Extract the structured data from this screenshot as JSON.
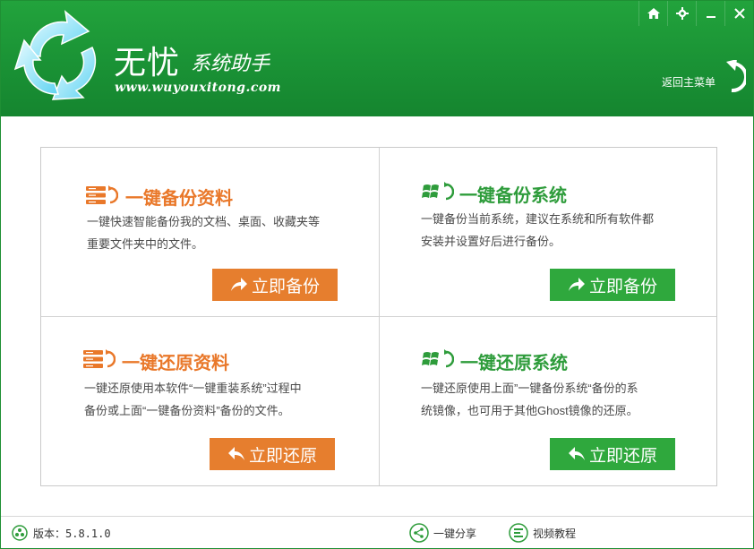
{
  "header": {
    "brand_name": "无忧",
    "brand_sub": "系统助手",
    "brand_url": "www.wuyouxitong.com",
    "back_menu_label": "返回主菜单",
    "top_buttons": [
      "home-icon",
      "gear-icon",
      "minimize-icon",
      "close-icon"
    ]
  },
  "cells": {
    "backup_data": {
      "title": "一键备份资料",
      "desc_line1": "一键快速智能备份我的文档、桌面、收藏夹等",
      "desc_line2": "重要文件夹中的文件。",
      "button": "立即备份"
    },
    "backup_system": {
      "title": "一键备份系统",
      "desc_line1": "一键备份当前系统，建议在系统和所有软件都",
      "desc_line2": "安装并设置好后进行备份。",
      "button": "立即备份"
    },
    "restore_data": {
      "title": "一键还原资料",
      "desc_line1": "一键还原使用本软件“一键重装系统”过程中",
      "desc_line2": "备份或上面“一键备份资料”备份的文件。",
      "button": "立即还原"
    },
    "restore_system": {
      "title": "一键还原系统",
      "desc_line1": "一键还原使用上面”一键备份系统“备份的系",
      "desc_line2": "统镜像，也可用于其他Ghost镜像的还原。",
      "button": "立即还原"
    }
  },
  "footer": {
    "version": "版本：5.8.1.0",
    "share": "一键分享",
    "tutorial": "视频教程"
  },
  "colors": {
    "header_green": "#1a9235",
    "orange": "#e67e2e",
    "green_button": "#2fa83d",
    "green_title": "#2e9c3b"
  }
}
